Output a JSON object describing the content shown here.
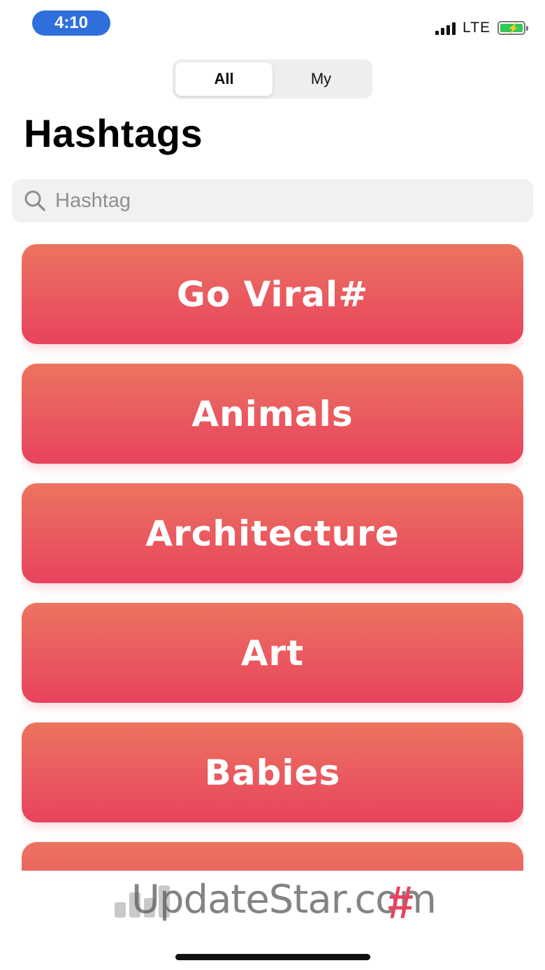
{
  "status_bar": {
    "time": "4:10",
    "network": "LTE"
  },
  "segments": {
    "items": [
      "All",
      "My"
    ],
    "selected": "All"
  },
  "header": {
    "title": "Hashtags"
  },
  "search": {
    "placeholder": "Hashtag",
    "icon": "search-icon"
  },
  "categories": [
    "Go Viral#",
    "Animals",
    "Architecture",
    "Art",
    "Babies",
    ""
  ],
  "tabbar": {
    "watermark": "UpdateStar.com",
    "hashtag_symbol": "#",
    "icons": [
      "chart-icon",
      "hashtag-icon"
    ]
  },
  "colors": {
    "accent": "#e8435e",
    "gradient_top": "#ec7460",
    "time_pill": "#2f6fdc"
  }
}
